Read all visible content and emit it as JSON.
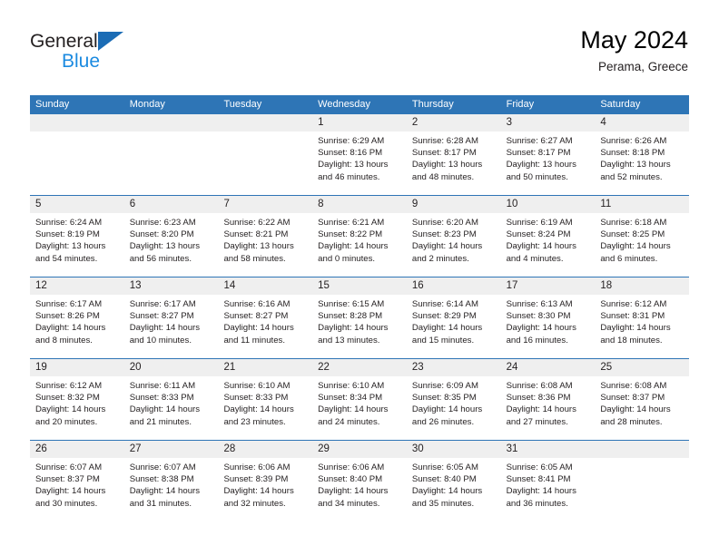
{
  "brand": {
    "line1": "General",
    "line2": "Blue",
    "mark": "triangle-logo"
  },
  "header": {
    "title": "May 2024",
    "subtitle": "Perama, Greece"
  },
  "labels": {
    "sunrise_prefix": "Sunrise:",
    "sunset_prefix": "Sunset:",
    "daylight_prefix": "Daylight:"
  },
  "colors": {
    "header_blue": "#2e75b6",
    "brand_blue": "#1b8ae0",
    "mark_blue": "#1b6cb5",
    "day_strip_gray": "#efefef",
    "text": "#231f20"
  },
  "weekdays": [
    "Sunday",
    "Monday",
    "Tuesday",
    "Wednesday",
    "Thursday",
    "Friday",
    "Saturday"
  ],
  "weeks": [
    [
      {
        "day": "",
        "empty": true
      },
      {
        "day": "",
        "empty": true
      },
      {
        "day": "",
        "empty": true
      },
      {
        "day": "1",
        "sunrise": "Sunrise: 6:29 AM",
        "sunset": "Sunset: 8:16 PM",
        "daylight": "Daylight: 13 hours and 46 minutes."
      },
      {
        "day": "2",
        "sunrise": "Sunrise: 6:28 AM",
        "sunset": "Sunset: 8:17 PM",
        "daylight": "Daylight: 13 hours and 48 minutes."
      },
      {
        "day": "3",
        "sunrise": "Sunrise: 6:27 AM",
        "sunset": "Sunset: 8:17 PM",
        "daylight": "Daylight: 13 hours and 50 minutes."
      },
      {
        "day": "4",
        "sunrise": "Sunrise: 6:26 AM",
        "sunset": "Sunset: 8:18 PM",
        "daylight": "Daylight: 13 hours and 52 minutes."
      }
    ],
    [
      {
        "day": "5",
        "sunrise": "Sunrise: 6:24 AM",
        "sunset": "Sunset: 8:19 PM",
        "daylight": "Daylight: 13 hours and 54 minutes."
      },
      {
        "day": "6",
        "sunrise": "Sunrise: 6:23 AM",
        "sunset": "Sunset: 8:20 PM",
        "daylight": "Daylight: 13 hours and 56 minutes."
      },
      {
        "day": "7",
        "sunrise": "Sunrise: 6:22 AM",
        "sunset": "Sunset: 8:21 PM",
        "daylight": "Daylight: 13 hours and 58 minutes."
      },
      {
        "day": "8",
        "sunrise": "Sunrise: 6:21 AM",
        "sunset": "Sunset: 8:22 PM",
        "daylight": "Daylight: 14 hours and 0 minutes."
      },
      {
        "day": "9",
        "sunrise": "Sunrise: 6:20 AM",
        "sunset": "Sunset: 8:23 PM",
        "daylight": "Daylight: 14 hours and 2 minutes."
      },
      {
        "day": "10",
        "sunrise": "Sunrise: 6:19 AM",
        "sunset": "Sunset: 8:24 PM",
        "daylight": "Daylight: 14 hours and 4 minutes."
      },
      {
        "day": "11",
        "sunrise": "Sunrise: 6:18 AM",
        "sunset": "Sunset: 8:25 PM",
        "daylight": "Daylight: 14 hours and 6 minutes."
      }
    ],
    [
      {
        "day": "12",
        "sunrise": "Sunrise: 6:17 AM",
        "sunset": "Sunset: 8:26 PM",
        "daylight": "Daylight: 14 hours and 8 minutes."
      },
      {
        "day": "13",
        "sunrise": "Sunrise: 6:17 AM",
        "sunset": "Sunset: 8:27 PM",
        "daylight": "Daylight: 14 hours and 10 minutes."
      },
      {
        "day": "14",
        "sunrise": "Sunrise: 6:16 AM",
        "sunset": "Sunset: 8:27 PM",
        "daylight": "Daylight: 14 hours and 11 minutes."
      },
      {
        "day": "15",
        "sunrise": "Sunrise: 6:15 AM",
        "sunset": "Sunset: 8:28 PM",
        "daylight": "Daylight: 14 hours and 13 minutes."
      },
      {
        "day": "16",
        "sunrise": "Sunrise: 6:14 AM",
        "sunset": "Sunset: 8:29 PM",
        "daylight": "Daylight: 14 hours and 15 minutes."
      },
      {
        "day": "17",
        "sunrise": "Sunrise: 6:13 AM",
        "sunset": "Sunset: 8:30 PM",
        "daylight": "Daylight: 14 hours and 16 minutes."
      },
      {
        "day": "18",
        "sunrise": "Sunrise: 6:12 AM",
        "sunset": "Sunset: 8:31 PM",
        "daylight": "Daylight: 14 hours and 18 minutes."
      }
    ],
    [
      {
        "day": "19",
        "sunrise": "Sunrise: 6:12 AM",
        "sunset": "Sunset: 8:32 PM",
        "daylight": "Daylight: 14 hours and 20 minutes."
      },
      {
        "day": "20",
        "sunrise": "Sunrise: 6:11 AM",
        "sunset": "Sunset: 8:33 PM",
        "daylight": "Daylight: 14 hours and 21 minutes."
      },
      {
        "day": "21",
        "sunrise": "Sunrise: 6:10 AM",
        "sunset": "Sunset: 8:33 PM",
        "daylight": "Daylight: 14 hours and 23 minutes."
      },
      {
        "day": "22",
        "sunrise": "Sunrise: 6:10 AM",
        "sunset": "Sunset: 8:34 PM",
        "daylight": "Daylight: 14 hours and 24 minutes."
      },
      {
        "day": "23",
        "sunrise": "Sunrise: 6:09 AM",
        "sunset": "Sunset: 8:35 PM",
        "daylight": "Daylight: 14 hours and 26 minutes."
      },
      {
        "day": "24",
        "sunrise": "Sunrise: 6:08 AM",
        "sunset": "Sunset: 8:36 PM",
        "daylight": "Daylight: 14 hours and 27 minutes."
      },
      {
        "day": "25",
        "sunrise": "Sunrise: 6:08 AM",
        "sunset": "Sunset: 8:37 PM",
        "daylight": "Daylight: 14 hours and 28 minutes."
      }
    ],
    [
      {
        "day": "26",
        "sunrise": "Sunrise: 6:07 AM",
        "sunset": "Sunset: 8:37 PM",
        "daylight": "Daylight: 14 hours and 30 minutes."
      },
      {
        "day": "27",
        "sunrise": "Sunrise: 6:07 AM",
        "sunset": "Sunset: 8:38 PM",
        "daylight": "Daylight: 14 hours and 31 minutes."
      },
      {
        "day": "28",
        "sunrise": "Sunrise: 6:06 AM",
        "sunset": "Sunset: 8:39 PM",
        "daylight": "Daylight: 14 hours and 32 minutes."
      },
      {
        "day": "29",
        "sunrise": "Sunrise: 6:06 AM",
        "sunset": "Sunset: 8:40 PM",
        "daylight": "Daylight: 14 hours and 34 minutes."
      },
      {
        "day": "30",
        "sunrise": "Sunrise: 6:05 AM",
        "sunset": "Sunset: 8:40 PM",
        "daylight": "Daylight: 14 hours and 35 minutes."
      },
      {
        "day": "31",
        "sunrise": "Sunrise: 6:05 AM",
        "sunset": "Sunset: 8:41 PM",
        "daylight": "Daylight: 14 hours and 36 minutes."
      },
      {
        "day": "",
        "empty": true
      }
    ]
  ]
}
